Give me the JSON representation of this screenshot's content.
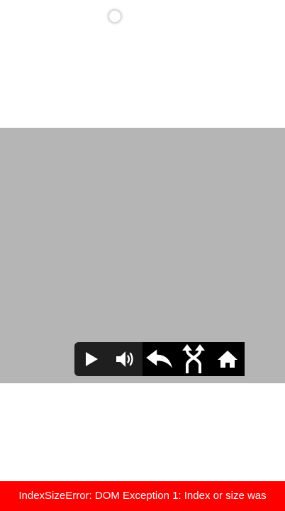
{
  "loader": {
    "icon": "loading-dot-icon"
  },
  "player": {
    "background_color": "#b5b5b5",
    "controls": [
      {
        "icon": "play-icon"
      },
      {
        "icon": "volume-icon"
      },
      {
        "icon": "back-arrow-icon"
      },
      {
        "icon": "branch-arrows-icon"
      },
      {
        "icon": "home-icon"
      }
    ]
  },
  "error": {
    "message": "IndexSizeError: DOM Exception 1: Index or size was",
    "color": "#ff0000"
  }
}
